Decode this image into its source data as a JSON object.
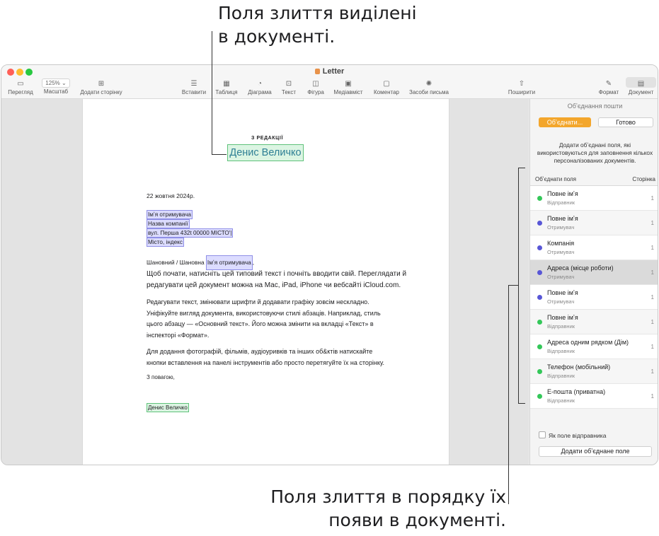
{
  "callouts": {
    "top_line1": "Поля злиття виділені",
    "top_line2": "в документі.",
    "bottom_line1": "Поля злиття в порядку їх",
    "bottom_line2": "появи в документі."
  },
  "window": {
    "title": "Letter"
  },
  "toolbar": {
    "view": "Перегляд",
    "zoom_value": "125%",
    "zoom": "Масштаб",
    "add_page": "Додати сторінку",
    "insert": "Вставити",
    "table": "Таблиця",
    "chart": "Діаграма",
    "text": "Текст",
    "shape": "Фігура",
    "media": "Медіавміст",
    "comment": "Коментар",
    "writing_tools": "Засоби письма",
    "share": "Поширити",
    "format": "Формат",
    "document": "Документ"
  },
  "letter": {
    "heading": "З РЕДАКЦІЇ",
    "sender_name": "Денис Величко",
    "date": "22 жовтня 2024р.",
    "recipient_name": "Імʼя отримувача",
    "company": "Назва компанії",
    "street": "вул. Перша 432t 00000 МІСТО'|",
    "city": "Місто, індекс",
    "greeting": "Шановний / Шановна",
    "greeting_field": "Імʼя отримувача",
    "greeting_comma": ",",
    "p1_l1": "Щоб почати, натисніть цей типовий текст і почніть вводити свій. Переглядати й",
    "p1_l2": "редагувати цей документ можна на Mac, iPad, iPhone чи вебсайті iCloud.com.",
    "p2_l1": "Редагувати текст, змінювати шрифти й додавати графіку зовсім нескладно.",
    "p2_l2": "Уніфікуйте вигляд документа, використовуючи стилі абзаців. Наприклад, стиль",
    "p2_l3": "цього абзацу — «Основний текст». Його можна змінити на вкладці «Текст» в",
    "p2_l4": "інспекторі «Формат».",
    "p3_l1": "Для додання фотографій, фільмів, аудіоуривків та інших об&ктів натискайте",
    "p3_l2": "кнопки вставлення на панелі інструментів або просто перетягуйте їх на сторінку.",
    "closing": "З повагою,",
    "signature": "Денис Величко"
  },
  "sidebar": {
    "title": "Обʼєднання пошти",
    "merge_button": "Обʼєднати...",
    "done_button": "Готово",
    "description": "Додати обʼєднані поля, які використовуються для заповнення кількох персоналізованих документів.",
    "col_fields": "Обʼєднати поля",
    "col_page": "Сторінка",
    "fields": [
      {
        "name": "Повне імʼя",
        "source": "Відправник",
        "page": "1",
        "color": "#34c759"
      },
      {
        "name": "Повне імʼя",
        "source": "Отримувач",
        "page": "1",
        "color": "#5856d6"
      },
      {
        "name": "Компанія",
        "source": "Отримувач",
        "page": "1",
        "color": "#5856d6"
      },
      {
        "name": "Адреса (місце роботи)",
        "source": "Отримувач",
        "page": "1",
        "color": "#5856d6"
      },
      {
        "name": "Повне імʼя",
        "source": "Отримувач",
        "page": "1",
        "color": "#5856d6"
      },
      {
        "name": "Повне імʼя",
        "source": "Відправник",
        "page": "1",
        "color": "#34c759"
      },
      {
        "name": "Адреса одним рядком (Дім)",
        "source": "Відправник",
        "page": "1",
        "color": "#34c759"
      },
      {
        "name": "Телефон (мобільний)",
        "source": "Відправник",
        "page": "1",
        "color": "#34c759"
      },
      {
        "name": "Е-пошта (приватна)",
        "source": "Відправник",
        "page": "1",
        "color": "#34c759"
      }
    ],
    "sender_checkbox": "Як поле відправника",
    "add_button": "Додати обʼєднане поле"
  }
}
